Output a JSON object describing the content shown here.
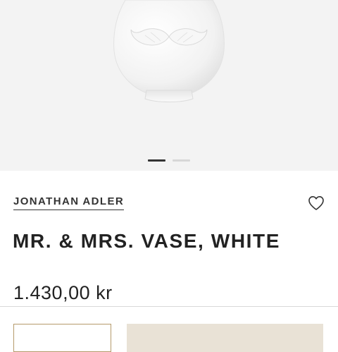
{
  "product": {
    "brand": "JONATHAN ADLER",
    "title": "MR. & MRS. VASE, WHITE",
    "price": "1.430,00 kr"
  },
  "gallery": {
    "image_count": 2,
    "active_index": 0
  },
  "icons": {
    "favorite": "heart-outline-icon"
  },
  "colors": {
    "gallery_bg": "#f3f3f3",
    "accent_border": "#b59a6a",
    "cart_button_bg": "#e9e2d6",
    "text": "#222222"
  }
}
